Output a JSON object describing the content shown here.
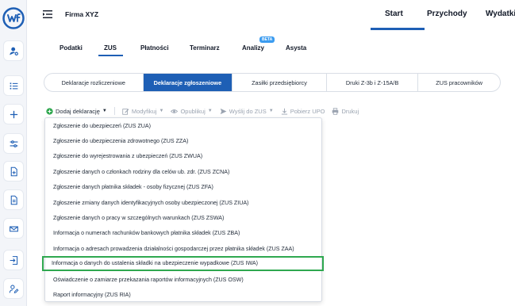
{
  "company": "Firma XYZ",
  "top_nav": [
    "Start",
    "Przychody",
    "Wydatki"
  ],
  "module_tabs": [
    "Podatki",
    "ZUS",
    "Płatności",
    "Terminarz",
    "Analizy",
    "Asysta"
  ],
  "beta_badge": "BETA",
  "sub_tabs": [
    "Deklaracje rozliczeniowe",
    "Deklaracje zgłoszeniowe",
    "Zasiłki przedsiębiorcy",
    "Druki Z-3b i Z-15A/B",
    "ZUS pracowników"
  ],
  "toolbar": {
    "add": "Dodaj deklarację",
    "modify": "Modyfikuj",
    "publish": "Opublikuj",
    "send": "Wyślij do ZUS",
    "upo": "Pobierz UPO",
    "print": "Drukuj"
  },
  "dropdown_items": [
    "Zgłoszenie do ubezpieczeń (ZUS ZUA)",
    "Zgłoszenie do ubezpieczenia zdrowotnego (ZUS ZZA)",
    "Zgłoszenie do wyrejestrowania z ubezpieczeń (ZUS ZWUA)",
    "Zgłoszenie danych o członkach rodziny dla celów ub. zdr. (ZUS ZCNA)",
    "Zgłoszenie danych płatnika składek - osoby fizycznej (ZUS ZFA)",
    "Zgłoszenie zmiany danych identyfikacyjnych osoby ubezpieczonej (ZUS ZIUA)",
    "Zgłoszenie danych o pracy w szczególnych warunkach (ZUS ZSWA)",
    "Informacja o numerach rachunków bankowych płatnika składek (ZUS ZBA)",
    "Informacja o adresach prowadzenia działalności gospodarczej przez płatnika składek (ZUS ZAA)",
    "Informacja o danych do ustalenia składki na ubezpieczenie wypadkowe (ZUS IWA)",
    "Oświadczenie o zamiarze przekazania raportów informacyjnych (ZUS OSW)",
    "Raport informacyjny (ZUS RIA)"
  ],
  "colors": {
    "primary": "#1e5fb5",
    "highlight": "#2fa84f",
    "beta": "#3b9cf0"
  },
  "icons": {
    "sidebar": [
      "user-settings-icon",
      "list-icon",
      "plus-icon",
      "filters-icon",
      "document-plus-icon",
      "document-icon",
      "inbox-icon",
      "import-icon",
      "user-edit-icon"
    ]
  }
}
